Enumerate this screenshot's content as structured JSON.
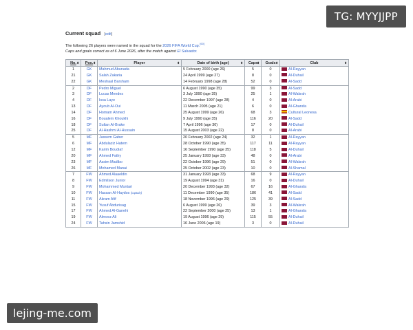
{
  "watermarks": {
    "top": "TG: MYYJJPP",
    "bottom": "lejing-me.com"
  },
  "section": {
    "title": "Current squad",
    "edit_prefix": "[",
    "edit_label": "edit",
    "edit_suffix": "]",
    "intro_text": "The following 26 players were named in the squad for the ",
    "intro_link": "2026 FIFA World Cup.",
    "intro_ref": "[60]",
    "intro_line2": "Caps and goals correct as of 6 June 2026, after the match against ",
    "intro_line2_link": "El Salvador."
  },
  "table": {
    "headers": [
      {
        "label": "No.",
        "underline": true
      },
      {
        "label": "Pos.",
        "underline": true
      },
      {
        "label": "Player",
        "underline": false
      },
      {
        "label": "Date of birth (age)",
        "underline": false
      },
      {
        "label": "Caps",
        "underline": false
      },
      {
        "label": "Goals",
        "underline": false
      },
      {
        "label": "Club",
        "underline": false
      }
    ],
    "sort_icon": "sort-icon",
    "flag_colors": {
      "qatar": "#8a1538",
      "spain": "spain-flag"
    },
    "rows": [
      {
        "no": "1",
        "pos": "GK",
        "player": "Mahmud Abunada",
        "dob": "5 February 2000 (age 26)",
        "caps": "5",
        "goals": "0",
        "club": "Al-Rayyan",
        "flag": "qatar",
        "gap": false
      },
      {
        "no": "21",
        "pos": "GK",
        "player": "Salah Zakaria",
        "dob": "24 April 1999 (age 27)",
        "caps": "8",
        "goals": "0",
        "club": "Al-Duhail",
        "flag": "qatar",
        "gap": false
      },
      {
        "no": "22",
        "pos": "GK",
        "player": "Meshaal Barsham",
        "dob": "14 February 1998 (age 28)",
        "caps": "52",
        "goals": "0",
        "club": "Al-Sadd",
        "flag": "qatar",
        "gap": false
      },
      {
        "no": "2",
        "pos": "DF",
        "player": "Pedro Miguel",
        "dob": "6 August 1990 (age 35)",
        "caps": "99",
        "goals": "3",
        "club": "Al-Sadd",
        "flag": "qatar",
        "gap": true
      },
      {
        "no": "3",
        "pos": "DF",
        "player": "Lucas Mendes",
        "dob": "3 July 1990 (age 35)",
        "caps": "25",
        "goals": "1",
        "club": "Al-Wakrah",
        "flag": "qatar",
        "gap": false
      },
      {
        "no": "4",
        "pos": "DF",
        "player": "Issa Laye",
        "dob": "22 December 1997 (age 28)",
        "caps": "4",
        "goals": "0",
        "club": "Al-Arabi",
        "flag": "qatar",
        "gap": false
      },
      {
        "no": "13",
        "pos": "DF",
        "player": "Ayoub Al-Oui",
        "dob": "11 March 2005 (age 21)",
        "caps": "6",
        "goals": "0",
        "club": "Al-Gharafa",
        "flag": "qatar",
        "gap": false
      },
      {
        "no": "14",
        "pos": "DF",
        "player": "Homam Ahmed",
        "dob": "25 August 1999 (age 26)",
        "caps": "68",
        "goals": "3",
        "club": "Cultural Leonesa",
        "flag": "spain",
        "gap": false
      },
      {
        "no": "16",
        "pos": "DF",
        "player": "Boualem Khoukhi",
        "dob": "9 July 1990 (age 35)",
        "caps": "116",
        "goals": "20",
        "club": "Al-Sadd",
        "flag": "qatar",
        "gap": false
      },
      {
        "no": "18",
        "pos": "DF",
        "player": "Sultan Al-Brake",
        "dob": "7 April 1996 (age 30)",
        "caps": "17",
        "goals": "0",
        "club": "Al-Duhail",
        "flag": "qatar",
        "gap": false
      },
      {
        "no": "25",
        "pos": "DF",
        "player": "Al-Hashmi Al-Hussain",
        "dob": "15 August 2003 (age 22)",
        "caps": "8",
        "goals": "0",
        "club": "Al-Arabi",
        "flag": "qatar",
        "gap": false
      },
      {
        "no": "5",
        "pos": "MF",
        "player": "Jassem Gaber",
        "dob": "20 February 2002 (age 24)",
        "caps": "32",
        "goals": "1",
        "club": "Al-Rayyan",
        "flag": "qatar",
        "gap": true
      },
      {
        "no": "6",
        "pos": "MF",
        "player": "Abdulaziz Hatem",
        "dob": "28 October 1990 (age 35)",
        "caps": "117",
        "goals": "11",
        "club": "Al-Rayyan",
        "flag": "qatar",
        "gap": false
      },
      {
        "no": "12",
        "pos": "MF",
        "player": "Karim Boudiaf",
        "dob": "16 September 1990 (age 35)",
        "caps": "118",
        "goals": "5",
        "club": "Al-Duhail",
        "flag": "qatar",
        "gap": false
      },
      {
        "no": "20",
        "pos": "MF",
        "player": "Ahmed Fathy",
        "dob": "25 January 1993 (age 33)",
        "caps": "48",
        "goals": "0",
        "club": "Al-Arabi",
        "flag": "qatar",
        "gap": false
      },
      {
        "no": "23",
        "pos": "MF",
        "player": "Assim Madibo",
        "dob": "22 October 1996 (age 29)",
        "caps": "51",
        "goals": "0",
        "club": "Al-Wakrah",
        "flag": "qatar",
        "gap": false
      },
      {
        "no": "26",
        "pos": "MF",
        "player": "Mohamed Manai",
        "dob": "25 October 2002 (age 23)",
        "caps": "10",
        "goals": "0",
        "club": "Al-Shamal",
        "flag": "qatar",
        "gap": false
      },
      {
        "no": "7",
        "pos": "FW",
        "player": "Ahmed Alaaeldin",
        "dob": "31 January 1993 (age 33)",
        "caps": "68",
        "goals": "9",
        "club": "Al-Rayyan",
        "flag": "qatar",
        "gap": true
      },
      {
        "no": "8",
        "pos": "FW",
        "player": "Edmilson Junior",
        "dob": "19 August 1994 (age 31)",
        "caps": "16",
        "goals": "0",
        "club": "Al-Duhail",
        "flag": "qatar",
        "gap": false
      },
      {
        "no": "9",
        "pos": "FW",
        "player": "Mohammed Muntari",
        "dob": "20 December 1993 (age 32)",
        "caps": "67",
        "goals": "16",
        "club": "Al-Gharafa",
        "flag": "qatar",
        "gap": false
      },
      {
        "no": "10",
        "pos": "FW",
        "player": "Hassan Al-Haydos",
        "captain": "(captain)",
        "dob": "11 December 1990 (age 35)",
        "caps": "186",
        "goals": "41",
        "club": "Al-Sadd",
        "flag": "qatar",
        "gap": false
      },
      {
        "no": "11",
        "pos": "FW",
        "player": "Akram Afif",
        "dob": "18 November 1996 (age 29)",
        "caps": "125",
        "goals": "39",
        "club": "Al-Sadd",
        "flag": "qatar",
        "gap": false
      },
      {
        "no": "15",
        "pos": "FW",
        "player": "Yusuf Abdurisag",
        "dob": "6 August 1999 (age 26)",
        "caps": "39",
        "goals": "3",
        "club": "Al-Wakrah",
        "flag": "qatar",
        "gap": false
      },
      {
        "no": "17",
        "pos": "FW",
        "player": "Ahmed Al-Ganehi",
        "dob": "22 September 2000 (age 25)",
        "caps": "13",
        "goals": "1",
        "club": "Al-Gharafa",
        "flag": "qatar",
        "gap": false
      },
      {
        "no": "19",
        "pos": "FW",
        "player": "Almoez Ali",
        "dob": "19 August 1996 (age 29)",
        "caps": "115",
        "goals": "55",
        "club": "Al-Duhail",
        "flag": "qatar",
        "gap": false
      },
      {
        "no": "24",
        "pos": "FW",
        "player": "Tahsin Jamshid",
        "dob": "16 June 2006 (age 19)",
        "caps": "3",
        "goals": "0",
        "club": "Al-Duhail",
        "flag": "qatar",
        "gap": false
      }
    ]
  }
}
